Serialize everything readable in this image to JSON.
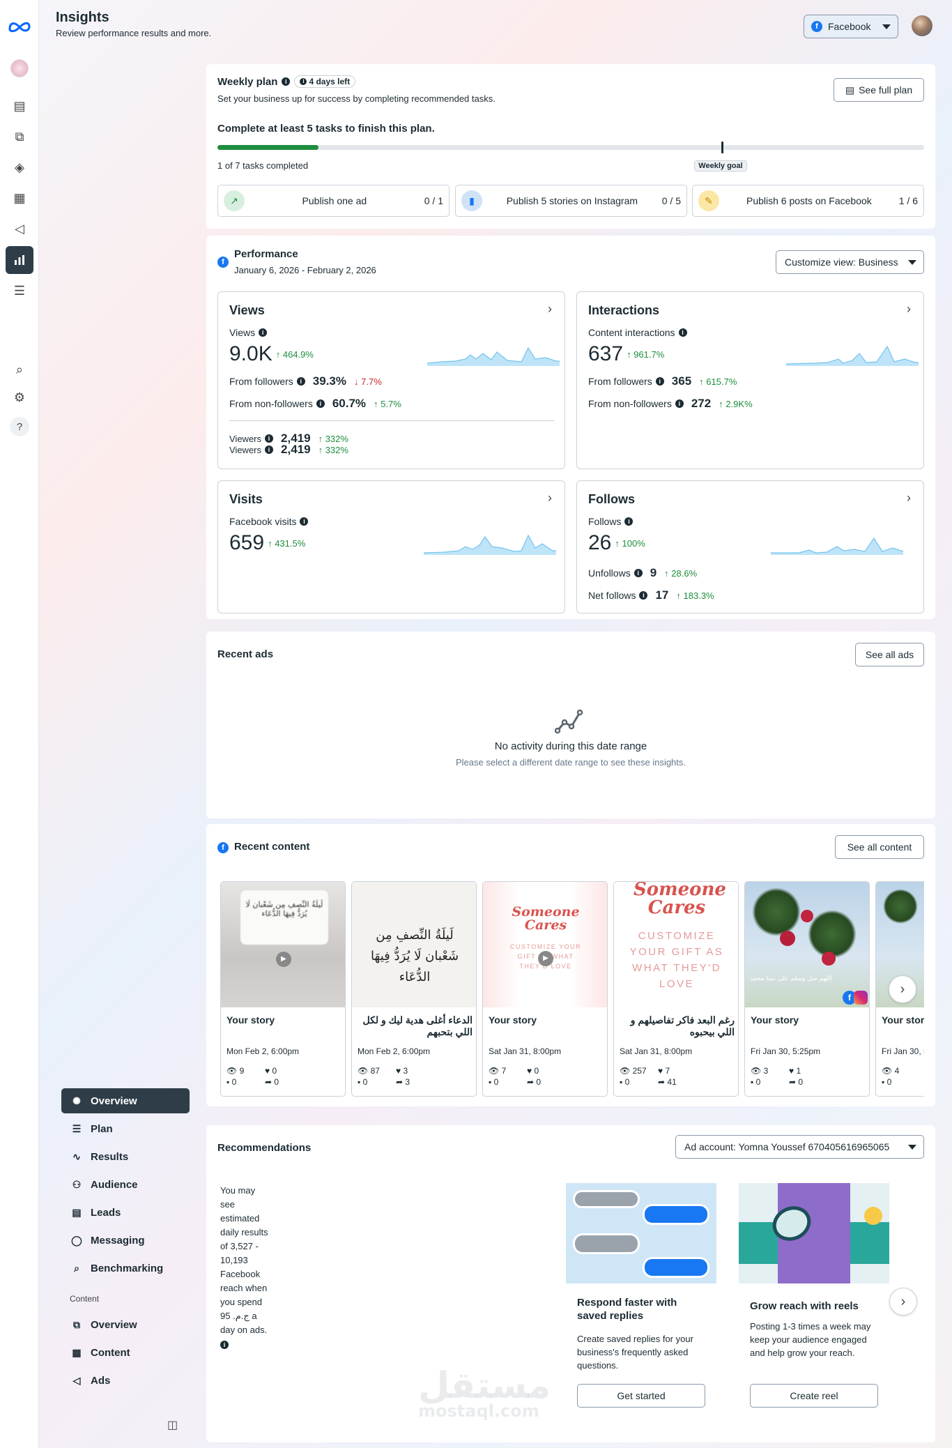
{
  "app": {
    "title": "Insights",
    "subtitle": "Review performance results and more."
  },
  "platform_select": {
    "value": "Facebook"
  },
  "weekly_plan": {
    "title": "Weekly plan",
    "badge": "4 days left",
    "subtitle": "Set your business up for success by completing recommended tasks.",
    "see_full_plan": "See full plan",
    "goal_text": "Complete at least 5 tasks to finish this plan.",
    "progress": 0.143,
    "goal_position": 0.7143,
    "completed_text": "1 of 7 tasks completed",
    "goal_label": "Weekly goal",
    "tasks": [
      {
        "label": "Publish one ad",
        "count": "0 / 1"
      },
      {
        "label": "Publish 5 stories on Instagram",
        "count": "0 / 5"
      },
      {
        "label": "Publish 6 posts on Facebook",
        "count": "1 / 6"
      }
    ]
  },
  "performance": {
    "title": "Performance",
    "date_range": "January 6, 2026 - February 2, 2026",
    "customize": "Customize view: Business",
    "views": {
      "title": "Views",
      "label": "Views",
      "value": "9.0K",
      "change": "464.9%",
      "followers_label": "From followers",
      "followers_value": "39.3%",
      "followers_change": "7.7%",
      "nonfollowers_label": "From non-followers",
      "nonfollowers_value": "60.7%",
      "nonfollowers_change": "5.7%",
      "viewers_label": "Viewers",
      "viewers_value": "2,419",
      "viewers_change": "332%"
    },
    "interactions": {
      "title": "Interactions",
      "label": "Content interactions",
      "value": "637",
      "change": "961.7%",
      "followers_label": "From followers",
      "followers_value": "365",
      "followers_change": "615.7%",
      "nonfollowers_label": "From non-followers",
      "nonfollowers_value": "272",
      "nonfollowers_change": "2.9K%"
    },
    "visits": {
      "title": "Visits",
      "label": "Facebook visits",
      "value": "659",
      "change": "431.5%"
    },
    "follows": {
      "title": "Follows",
      "label": "Follows",
      "value": "26",
      "change": "100%",
      "unfollows_label": "Unfollows",
      "unfollows_value": "9",
      "unfollows_change": "28.6%",
      "net_label": "Net follows",
      "net_value": "17",
      "net_change": "183.3%"
    }
  },
  "recent_ads": {
    "title": "Recent ads",
    "see_all": "See all ads",
    "empty_title": "No activity during this date range",
    "empty_sub": "Please select a different date range to see these insights."
  },
  "recent_content": {
    "title": "Recent content",
    "see_all": "See all content",
    "items": [
      {
        "title": "Your story",
        "date": "Mon Feb 2, 6:00pm",
        "views": "9",
        "likes": "0",
        "comments": "0",
        "shares": "0",
        "thumb_text": "لَيلَةُ النِّصفِ مِن شَعْبان لَا يُرَدُّ فِيهَا الدُّعَاء"
      },
      {
        "title": "الدعاء أغلى هدية ليك و لكل اللي بتحبهم",
        "date": "Mon Feb 2, 6:00pm",
        "views": "87",
        "likes": "3",
        "comments": "0",
        "shares": "3",
        "thumb_text": "لَيلَةُ النِّصفِ مِن شَعْبان لَا يُرَدُّ فِيهَا الدُّعَاء"
      },
      {
        "title": "Your story",
        "date": "Sat Jan 31, 8:00pm",
        "views": "7",
        "likes": "0",
        "comments": "0",
        "shares": "0",
        "thumb_text": "Someone Cares",
        "thumb_sub": "CUSTOMIZE YOUR GIFT AS WHAT THEY'D LOVE"
      },
      {
        "title": "رغم البعد فاكر تفاصيلهم و اللي بيحبوه",
        "date": "Sat Jan 31, 8:00pm",
        "views": "257",
        "likes": "7",
        "comments": "0",
        "shares": "41",
        "thumb_text": "Someone Cares",
        "thumb_sub": "CUSTOMIZE YOUR GIFT AS WHAT THEY'D LOVE"
      },
      {
        "title": "Your story",
        "date": "Fri Jan 30, 5:25pm",
        "views": "3",
        "likes": "1",
        "comments": "0",
        "shares": "0",
        "thumb_text": "اللهم صل وسلم على نبينا محمد"
      },
      {
        "title": "Your stor",
        "date": "Fri Jan 30, 5",
        "views": "4",
        "likes": "",
        "comments": "0",
        "shares": ""
      }
    ]
  },
  "sidebar_nav": {
    "items": [
      {
        "label": "Overview"
      },
      {
        "label": "Plan"
      },
      {
        "label": "Results"
      },
      {
        "label": "Audience"
      },
      {
        "label": "Leads"
      },
      {
        "label": "Messaging"
      },
      {
        "label": "Benchmarking"
      }
    ],
    "content_header": "Content",
    "content_items": [
      {
        "label": "Overview"
      },
      {
        "label": "Content"
      },
      {
        "label": "Ads"
      }
    ]
  },
  "recommendations": {
    "title": "Recommendations",
    "ad_account": "Ad account: Yomna Youssef 670405616965065",
    "estimate": "You may see estimated daily results of 3,527 - 10,193 Facebook reach when you spend 95 ج.م.‏ a day on ads.",
    "cards": [
      {
        "title": "Respond faster with saved replies",
        "body": "Create saved replies for your business's frequently asked questions.",
        "cta": "Get started"
      },
      {
        "title": "Grow reach with reels",
        "body": "Posting 1-3 times a week may keep your audience engaged and help grow your reach.",
        "cta": "Create reel"
      }
    ]
  },
  "watermark": {
    "text": "مستقل",
    "sub": "mostaql.com"
  },
  "colors": {
    "accent": "#1877f2",
    "green": "#1e8e3e",
    "dark": "#2f3d48",
    "spark": "#bfe4f8"
  }
}
